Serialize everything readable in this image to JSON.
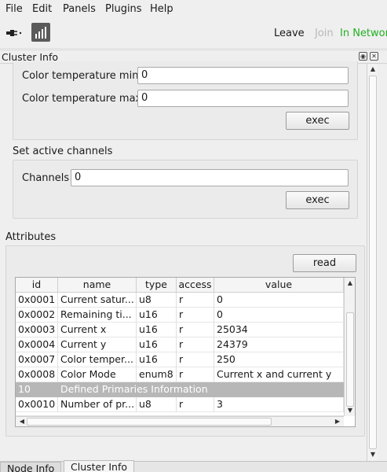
{
  "menu": {
    "items": [
      "File",
      "Edit",
      "Panels",
      "Plugins",
      "Help"
    ]
  },
  "toolbar": {
    "connect_icon": "plug-icon",
    "signal_icon": "signal-bars-icon",
    "leave_label": "Leave",
    "join_label": "Join",
    "network_status": "In Network",
    "network_status_color": "#22b022"
  },
  "dock": {
    "title": "Cluster Info",
    "float_icon": "float-icon",
    "close_icon": "close-icon"
  },
  "color_temp": {
    "min_label": "Color temperature min",
    "min_value": "0",
    "max_label": "Color temperature max",
    "max_value": "0",
    "exec_label": "exec"
  },
  "active_channels": {
    "title": "Set active channels",
    "channels_label": "Channels",
    "channels_value": "0",
    "exec_label": "exec"
  },
  "attributes": {
    "title": "Attributes",
    "read_label": "read",
    "columns": [
      "id",
      "name",
      "type",
      "access",
      "value"
    ],
    "rows": [
      {
        "id": "0x0001",
        "name": "Current satur...",
        "type": "u8",
        "access": "r",
        "value": "0"
      },
      {
        "id": "0x0002",
        "name": "Remaining ti...",
        "type": "u16",
        "access": "r",
        "value": "0"
      },
      {
        "id": "0x0003",
        "name": "Current x",
        "type": "u16",
        "access": "r",
        "value": "25034"
      },
      {
        "id": "0x0004",
        "name": "Current y",
        "type": "u16",
        "access": "r",
        "value": "24379"
      },
      {
        "id": "0x0007",
        "name": "Color temper...",
        "type": "u16",
        "access": "r",
        "value": "250"
      },
      {
        "id": "0x0008",
        "name": "Color Mode",
        "type": "enum8",
        "access": "r",
        "value": "Current x and current y"
      }
    ],
    "section_row": {
      "id": "10",
      "name": "Defined Primaries Information"
    },
    "last_row": {
      "id": "0x0010",
      "name": "Number of pr...",
      "type": "u8",
      "access": "r",
      "value": "3"
    }
  },
  "bottom_tabs": [
    "Node Info",
    "Cluster Info"
  ],
  "active_tab": "Cluster Info"
}
